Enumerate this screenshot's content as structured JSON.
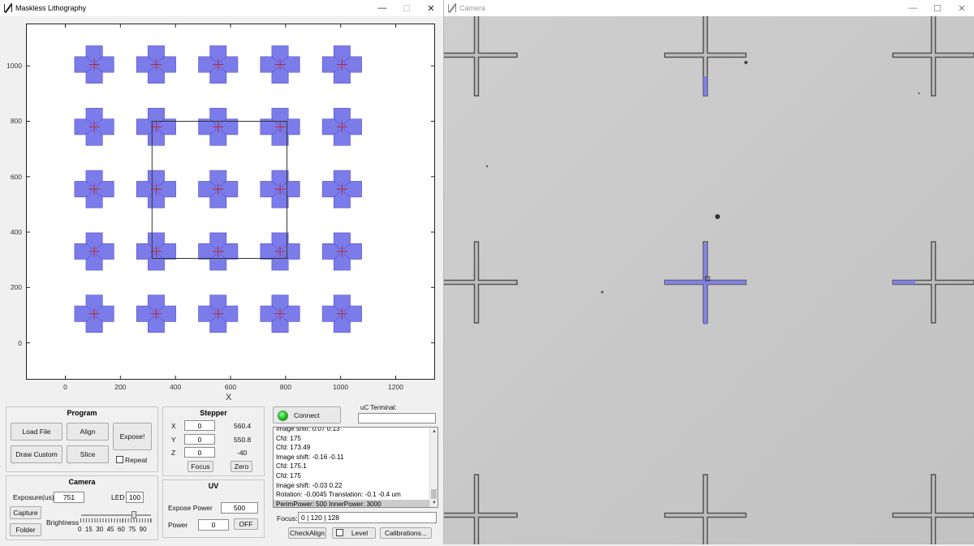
{
  "main_window": {
    "title": "Maskless Lithography",
    "controls": {
      "minimize": "—",
      "maximize": "☐",
      "close": "✕"
    }
  },
  "plot": {
    "xlabel": "X",
    "x_ticks": [
      "0",
      "200",
      "400",
      "600",
      "800",
      "1000",
      "1200"
    ],
    "y_ticks": [
      "1000",
      "800",
      "600",
      "400",
      "200",
      "0"
    ],
    "xlim": [
      -140,
      1340
    ],
    "ylim": [
      -130,
      1150
    ],
    "cross_centers_x": [
      105,
      330,
      555,
      780,
      1005
    ],
    "cross_centers_y": [
      1005,
      780,
      555,
      330,
      105
    ],
    "fill_color": "#7b7bea",
    "stroke_color": "#5555cc",
    "mark_color": "#c02020",
    "region": {
      "x_min": 315,
      "x_max": 805,
      "y_min": 305,
      "y_max": 800
    }
  },
  "program": {
    "title": "Program",
    "load_file": "Load File",
    "align": "Align",
    "expose": "Expose!",
    "draw_custom": "Draw Custom",
    "slice": "Slice",
    "repeat": "Repeat"
  },
  "stepper": {
    "title": "Stepper",
    "x_label": "X",
    "x_value": "0",
    "x_pos": "560.4",
    "y_label": "Y",
    "y_value": "0",
    "y_pos": "550.8",
    "z_label": "Z",
    "z_value": "0",
    "z_pos": "-40",
    "focus": "Focus",
    "zero": "Zero"
  },
  "camera_panel": {
    "title": "Camera",
    "exposure_label": "Exposure(us)",
    "exposure_value": "751",
    "led_label": "LED",
    "led_value": "100",
    "capture": "Capture",
    "folder": "Folder",
    "brightness_label": "Brightness",
    "brightness_ticks": "0  15  30  45  60  75  90",
    "brightness_level": 0.75
  },
  "uv": {
    "title": "UV",
    "expose_power_label": "Expose Power",
    "expose_power_value": "500",
    "power_label": "Power",
    "power_value": "0",
    "off": "OFF"
  },
  "comms": {
    "connect": "Connect",
    "status_color": "#1bb01b",
    "uc_terminal_label": "uC Terminal:",
    "uc_terminal_value": "",
    "log": [
      "Image shift: 0.07 0.13",
      "Cfd: 175",
      "Cfd: 173.49",
      "Image shift: -0.16 -0.11",
      "Cfd: 175.1",
      "Cfd: 175",
      "Image shift: -0.03 0.22",
      "Rotation: -0.0045 Translation: -0.1 -0.4 um",
      "PerimPower: 500 InnerPower: 3000"
    ],
    "focus_label": "Focus:",
    "focus_value": "0 | 120 | 128",
    "check_align": "CheckAlign",
    "level": "Level",
    "calibrations": "Calibrations..."
  },
  "camera_window": {
    "title": "Camera",
    "controls": {
      "minimize": "—",
      "maximize": "☐",
      "close": "✕"
    },
    "overlay_color": "#7a7ae6"
  }
}
